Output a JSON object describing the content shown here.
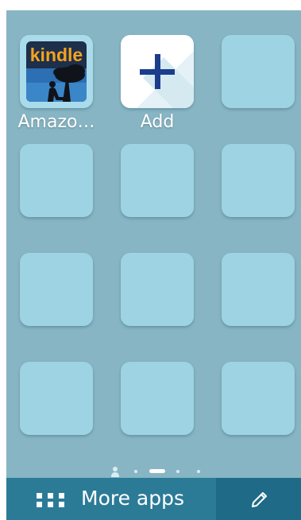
{
  "apps": [
    {
      "label": "Amazo…",
      "icon": "kindle-icon",
      "icon_text": "kindle"
    },
    {
      "label": "Add",
      "icon": "plus-icon"
    }
  ],
  "grid": {
    "columns": 3,
    "rows": 4,
    "empty_slots": 10
  },
  "page_indicator": {
    "pages": 4,
    "current_page": 2,
    "has_home_page": true
  },
  "bottom_bar": {
    "more_apps_label": "More apps",
    "more_apps_icon": "grid-dots-icon",
    "edit_icon": "pencil-icon"
  },
  "colors": {
    "background": "#87b5c3",
    "tile": "#9dd3e3",
    "bottom_bar": "#2b7b97",
    "kindle_orange": "#f4a21f",
    "plus_blue": "#1c3d8c"
  }
}
